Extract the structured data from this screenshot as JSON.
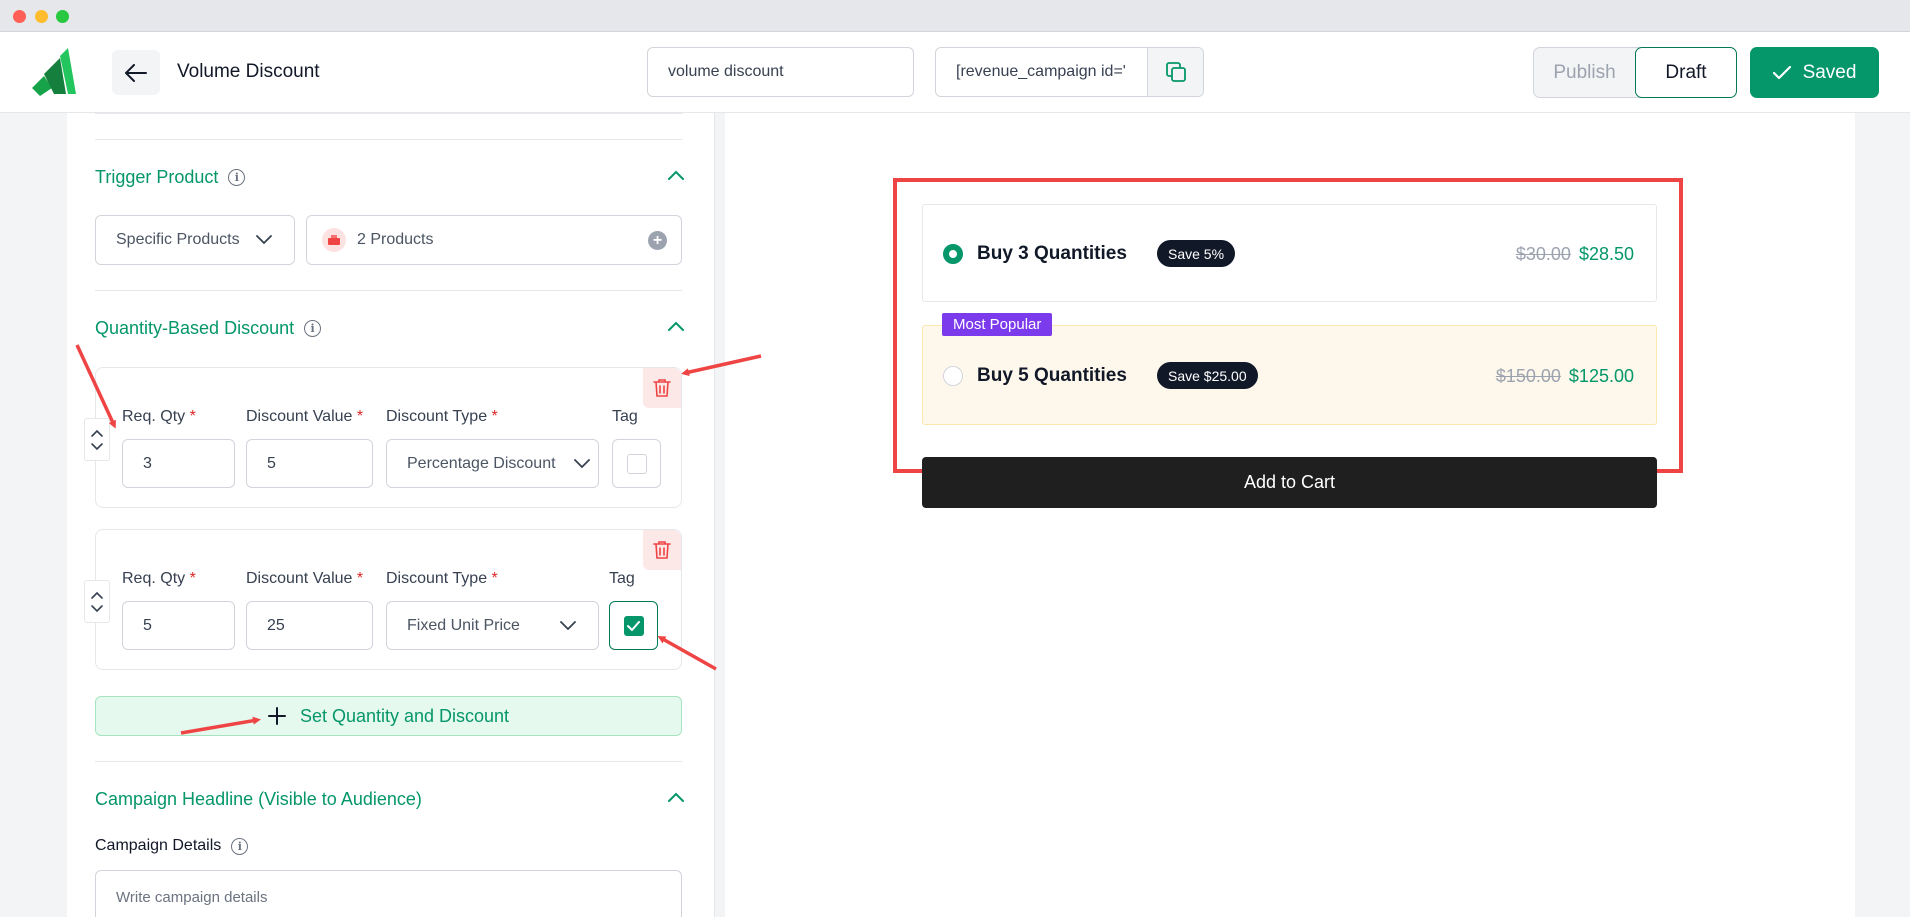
{
  "header": {
    "title": "Volume Discount",
    "campaign_name_value": "volume discount",
    "shortcode_value": "[revenue_campaign id='",
    "publish_label": "Publish",
    "draft_label": "Draft",
    "saved_label": "Saved"
  },
  "trigger": {
    "title": "Trigger Product",
    "scope_value": "Specific Products",
    "products_label": "2 Products"
  },
  "quantity_discount": {
    "title": "Quantity-Based Discount",
    "labels": {
      "req_qty": "Req. Qty",
      "discount_value": "Discount Value",
      "discount_type": "Discount Type",
      "tag": "Tag",
      "required_mark": "*"
    },
    "tiers": [
      {
        "qty": "3",
        "value": "5",
        "type": "Percentage Discount",
        "tag_checked": false
      },
      {
        "qty": "5",
        "value": "25",
        "type": "Fixed Unit Price",
        "tag_checked": true
      }
    ],
    "add_button_label": "Set Quantity and Discount"
  },
  "headline": {
    "title": "Campaign Headline (Visible to Audience)",
    "details_label": "Campaign Details",
    "details_placeholder": "Write campaign details"
  },
  "preview": {
    "offers": [
      {
        "title": "Buy 3 Quantities",
        "badge": "Save 5%",
        "old_price": "$30.00",
        "new_price": "$28.50",
        "selected": true
      },
      {
        "title": "Buy 5 Quantities",
        "badge": "Save $25.00",
        "old_price": "$150.00",
        "new_price": "$125.00",
        "selected": false,
        "ribbon": "Most Popular"
      }
    ],
    "cta_label": "Add to Cart"
  },
  "colors": {
    "brand_green": "#059669",
    "popular_purple": "#7c3aed",
    "annotation_red": "#ef4444"
  }
}
